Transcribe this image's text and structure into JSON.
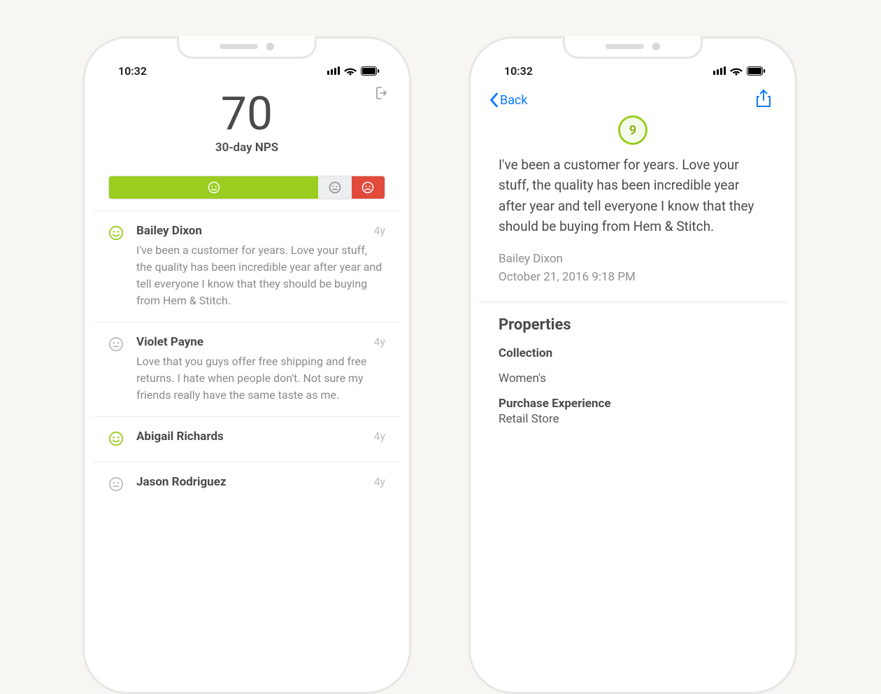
{
  "status": {
    "time": "10:32"
  },
  "left": {
    "score": "70",
    "score_label": "30-day NPS",
    "feed": [
      {
        "mood": "promoter",
        "name": "Bailey Dixon",
        "ago": "4y",
        "text": "I've been a customer for years. Love your stuff, the quality has been incredible year after year and tell everyone I know that they should be buying from Hem & Stitch."
      },
      {
        "mood": "passive",
        "name": "Violet Payne",
        "ago": "4y",
        "text": "Love that you guys offer free shipping and free returns. I hate when people don't. Not sure my friends really have the same taste as me."
      },
      {
        "mood": "promoter",
        "name": "Abigail Richards",
        "ago": "4y",
        "text": ""
      },
      {
        "mood": "passive",
        "name": "Jason Rodriguez",
        "ago": "4y",
        "text": ""
      }
    ]
  },
  "right": {
    "back_label": "Back",
    "score": "9",
    "quote": "I've been a customer for years. Love your stuff, the quality has been incredible year after year and tell everyone I know that they should be buying from Hem & Stitch.",
    "author": "Bailey Dixon",
    "timestamp": "October 21, 2016 9:18 PM",
    "properties_heading": "Properties",
    "props": [
      {
        "k": "Collection",
        "v": "Women's"
      },
      {
        "k": "Purchase Experience",
        "v": "Retail Store"
      }
    ]
  }
}
